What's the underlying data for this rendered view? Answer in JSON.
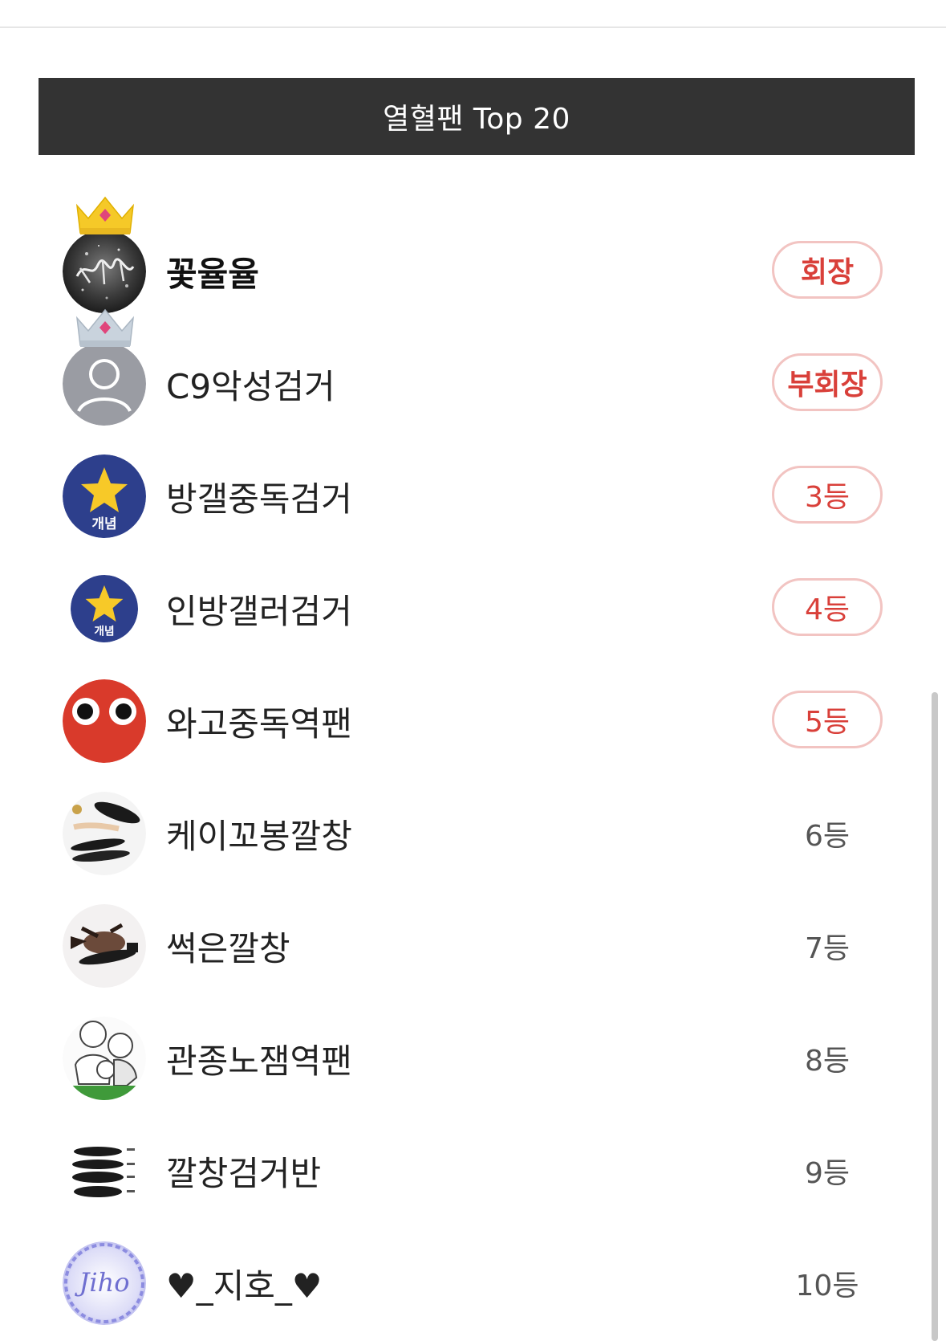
{
  "header": {
    "title": "열혈팬 Top 20"
  },
  "colors": {
    "header_bg": "#333333",
    "badge_border": "#f2c4c2",
    "badge_text": "#d9403a",
    "plain_rank_text": "#555555"
  },
  "fans": [
    {
      "name": "꽃율율",
      "rank_label": "회장",
      "crown": "gold",
      "avatar": "dark-calligraphy-avatar"
    },
    {
      "name": "C9악성검거",
      "rank_label": "부회장",
      "crown": "silver",
      "avatar": "default-user-avatar"
    },
    {
      "name": "방갤중독검거",
      "rank_label": "3등",
      "avatar": "star-concept-avatar",
      "avatar_text": "개념"
    },
    {
      "name": "인방갤러검거",
      "rank_label": "4등",
      "avatar": "star-concept-avatar",
      "avatar_text": "개념"
    },
    {
      "name": "와고중독역팬",
      "rank_label": "5등",
      "avatar": "red-eyes-avatar"
    },
    {
      "name": "케이꼬봉깔창",
      "rank_label": "6등",
      "avatar": "insole-photo-avatar"
    },
    {
      "name": "썩은깔창",
      "rank_label": "7등",
      "avatar": "shoe-fish-photo-avatar"
    },
    {
      "name": "관종노잼역팬",
      "rank_label": "8등",
      "avatar": "sketch-people-avatar"
    },
    {
      "name": "깔창검거반",
      "rank_label": "9등",
      "avatar": "insole-stack-avatar"
    },
    {
      "name": "♥_지호_♥",
      "rank_label": "10등",
      "avatar": "jiho-script-avatar",
      "avatar_text": "Jiho"
    }
  ]
}
